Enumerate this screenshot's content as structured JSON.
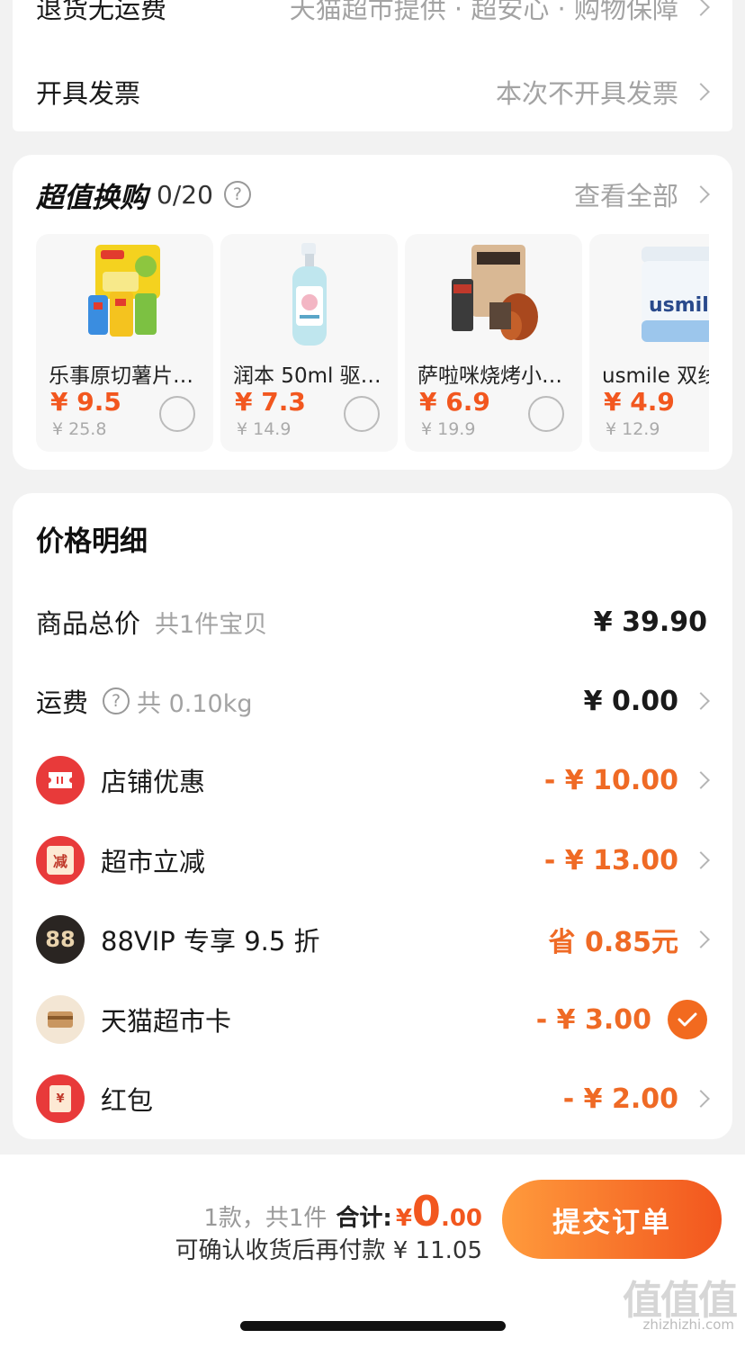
{
  "top_card": {
    "row1_label": "退货无运费",
    "row1_value": "天猫超市提供 · 超安心 · 购物保障",
    "invoice_label": "开具发票",
    "invoice_value": "本次不开具发票"
  },
  "swap": {
    "title": "超值换购",
    "count": "0/20",
    "view_all": "查看全部",
    "products": [
      {
        "name": "乐事原切薯片…",
        "price": "¥ 9.5",
        "orig": "¥ 25.8",
        "icon": "chips-bag-icon"
      },
      {
        "name": "润本 50ml 驱…",
        "price": "¥ 7.3",
        "orig": "¥ 14.9",
        "icon": "spray-bottle-icon"
      },
      {
        "name": "萨啦咪烧烤小…",
        "price": "¥ 6.9",
        "orig": "¥ 19.9",
        "icon": "chicken-snack-icon"
      },
      {
        "name": "usmile 双线",
        "price": "¥ 4.9",
        "orig": "¥ 12.9",
        "icon": "floss-box-icon"
      }
    ]
  },
  "price_detail": {
    "title": "价格明细",
    "items_total_label": "商品总价",
    "items_total_sub": "共1件宝贝",
    "items_total_value": "¥ 39.90",
    "shipping_label": "运费",
    "shipping_sub": "共 0.10kg",
    "shipping_value": "¥ 0.00",
    "store_discount_label": "店铺优惠",
    "store_discount_value": "- ¥ 10.00",
    "market_cut_label": "超市立减",
    "market_cut_icon_text": "减",
    "market_cut_value": "- ¥ 13.00",
    "vip_label": "88VIP 专享 9.5 折",
    "vip_icon_text": "88",
    "vip_value": "省 0.85元",
    "card_label": "天猫超市卡",
    "card_value": "- ¥ 3.00",
    "hongbao_label": "红包",
    "hongbao_icon_text": "¥",
    "hongbao_value": "- ¥ 2.00"
  },
  "footer": {
    "count_text": "1款，共1件",
    "total_label": "合计:",
    "currency": "¥",
    "total_int": "0",
    "total_dec": ".00",
    "pay_later": "可确认收货后再付款 ¥ 11.05",
    "submit_label": "提交订单",
    "watermark": "值值值",
    "watermark_url": "zhizhizhi.com"
  },
  "colors": {
    "accent": "#f2571f",
    "red_icon": "#e83a3a",
    "dark_icon": "#2a2522"
  }
}
